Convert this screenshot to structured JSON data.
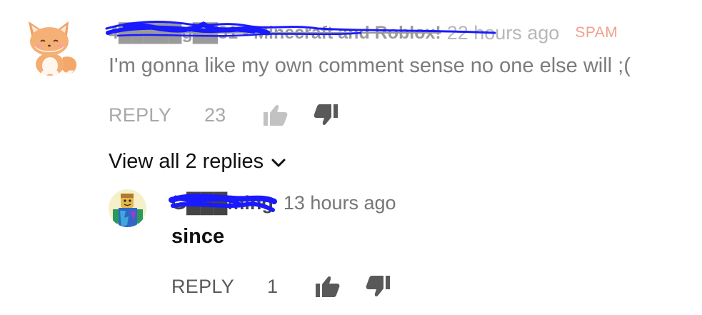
{
  "comment": {
    "author": "4█████g██31 - Minecraft and Roblox!",
    "timestamp": "22 hours ago",
    "spam_label": "SPAM",
    "text": "I'm gonna like my own comment sense no one else will ;(",
    "reply_label": "REPLY",
    "like_count": "23",
    "avatar_icon": "fox-avatar",
    "like_icon": "thumbs-up-icon",
    "dislike_icon": "thumbs-down-icon"
  },
  "view_replies": {
    "label": "View all 2 replies",
    "icon": "chevron-down-icon"
  },
  "reply": {
    "author": "G███ming",
    "timestamp": "13 hours ago",
    "text": "since",
    "reply_label": "REPLY",
    "like_count": "1",
    "avatar_icon": "roblox-character-avatar"
  },
  "colors": {
    "redaction_scribble": "#1a1aff",
    "spam": "#f0a08c",
    "muted_text": "#7c7c7c",
    "active_icon": "#595959",
    "faded_icon": "#c2c2c2"
  }
}
